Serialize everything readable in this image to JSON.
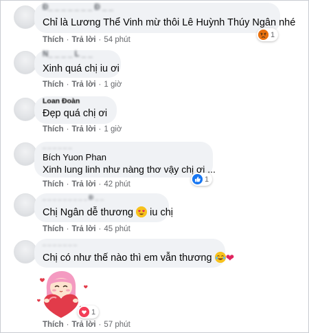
{
  "comments": [
    {
      "name": "",
      "text": "Chỉ là Lương Thể Vinh mừ thôi Lê Huỳnh Thúy Ngân nhé",
      "like": "Thích",
      "reply": "Trả lời",
      "time": "54 phút",
      "reaction_count": "1",
      "reaction": "angry-icon"
    },
    {
      "name": "",
      "text": "Xinh quá chị iu ơi",
      "like": "Thích",
      "reply": "Trả lời",
      "time": "1 giờ"
    },
    {
      "name": "Loan Đoàn",
      "text": "Đẹp quá chị ơi",
      "like": "Thích",
      "reply": "Trả lời",
      "time": "1 giờ"
    },
    {
      "name": "Bích Yuon Phan",
      "text": "Xinh lung linh như nàng thơ vậy chị ơi ...",
      "like": "Thích",
      "reply": "Trả lời",
      "time": "42 phút",
      "reaction_count": "1",
      "reaction": "like-icon"
    },
    {
      "name": "",
      "text": "Chị Ngân dễ thương",
      "text_after": "iu chị",
      "like": "Thích",
      "reply": "Trả lời",
      "time": "45 phút"
    },
    {
      "name": "",
      "text": "Chị có như thế nào thì em vẫn thương",
      "like": "Thích",
      "reply": "Trả lời",
      "time": "57 phút",
      "reaction_count": "1",
      "reaction": "love-icon"
    }
  ],
  "colors": {
    "bubble": "#f0f2f5",
    "meta": "#65676b",
    "like_blue": "#1877f2",
    "angry": "#e9710f",
    "heart": "#e0245e"
  }
}
